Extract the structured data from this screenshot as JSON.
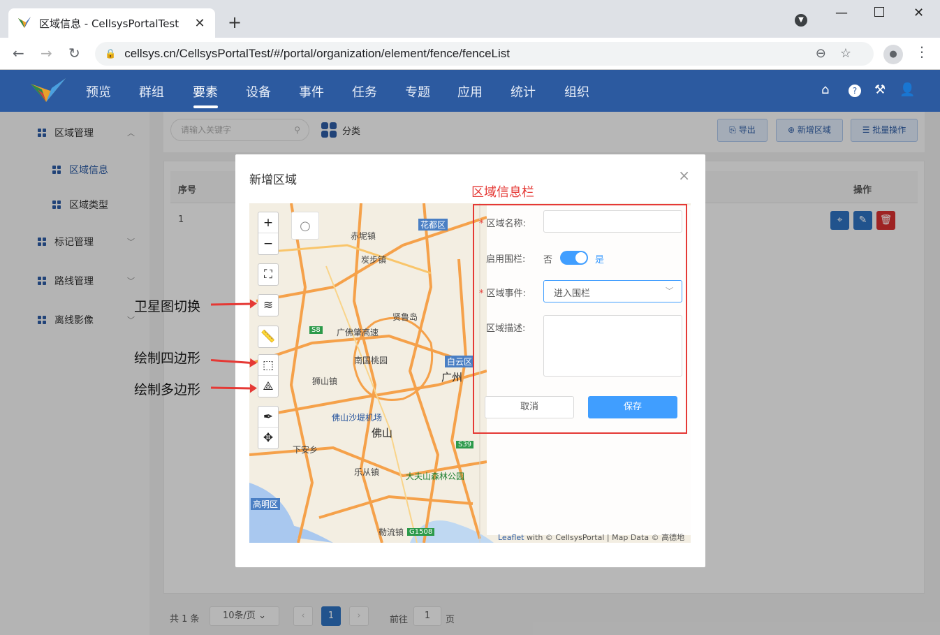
{
  "browser": {
    "tab_title": "区域信息 - CellsysPortalTest",
    "url": "cellsys.cn/CellsysPortalTest/#/portal/organization/element/fence/fenceList"
  },
  "topnav": {
    "items": [
      {
        "label": "预览"
      },
      {
        "label": "群组"
      },
      {
        "label": "要素",
        "active": true
      },
      {
        "label": "设备"
      },
      {
        "label": "事件"
      },
      {
        "label": "任务"
      },
      {
        "label": "专题"
      },
      {
        "label": "应用"
      },
      {
        "label": "统计"
      },
      {
        "label": "组织"
      }
    ]
  },
  "sidebar": {
    "items": [
      {
        "label": "区域管理"
      },
      {
        "label": "区域信息"
      },
      {
        "label": "区域类型"
      },
      {
        "label": "标记管理"
      },
      {
        "label": "路线管理"
      },
      {
        "label": "离线影像"
      }
    ]
  },
  "toolbar": {
    "search_placeholder": "请输入关键字",
    "category_label": "分类",
    "export_label": "导出",
    "add_label": "新增区域",
    "batch_label": "批量操作"
  },
  "table": {
    "col_index": "序号",
    "col_ops": "操作",
    "rows": [
      {
        "index": "1"
      }
    ]
  },
  "pagination": {
    "total": "共 1 条",
    "page_size": "10条/页",
    "current_page": "1",
    "goto_prefix": "前往",
    "goto_value": "1",
    "goto_suffix": "页"
  },
  "modal": {
    "title": "新增区域",
    "panel_caption": "区域信息栏",
    "form": {
      "name_label": "区域名称:",
      "fence_label": "启用围栏:",
      "fence_off": "否",
      "fence_on": "是",
      "fence_enabled": true,
      "event_label": "区域事件:",
      "event_value": "进入围栏",
      "desc_label": "区域描述:",
      "cancel_label": "取消",
      "save_label": "保存"
    },
    "map": {
      "labels": [
        {
          "text": "花都区",
          "style": "blue"
        },
        {
          "text": "赤坭镇",
          "style": ""
        },
        {
          "text": "炭步镇",
          "style": ""
        },
        {
          "text": "贤鲁岛",
          "style": ""
        },
        {
          "text": "S8",
          "style": "green-badge"
        },
        {
          "text": "广佛肇高速",
          "style": ""
        },
        {
          "text": "南国桃园",
          "style": ""
        },
        {
          "text": "白云区",
          "style": "blue"
        },
        {
          "text": "广州",
          "style": "big"
        },
        {
          "text": "狮山镇",
          "style": ""
        },
        {
          "text": "佛山沙堤机场",
          "style": "dark"
        },
        {
          "text": "佛山",
          "style": "big"
        },
        {
          "text": "下安乡",
          "style": ""
        },
        {
          "text": "S39",
          "style": "green-badge"
        },
        {
          "text": "乐从镇",
          "style": ""
        },
        {
          "text": "大夫山森林公园",
          "style": "green"
        },
        {
          "text": "高明区",
          "style": "blue"
        },
        {
          "text": "勒流镇",
          "style": ""
        },
        {
          "text": "G1508",
          "style": "green-badge"
        }
      ],
      "attribution_link": "Leaflet",
      "attribution_text": " with © CellsysPortal | Map Data © 高德地图"
    }
  },
  "annotations": {
    "satellite": "卫星图切换",
    "rect": "绘制四边形",
    "polygon": "绘制多边形"
  }
}
